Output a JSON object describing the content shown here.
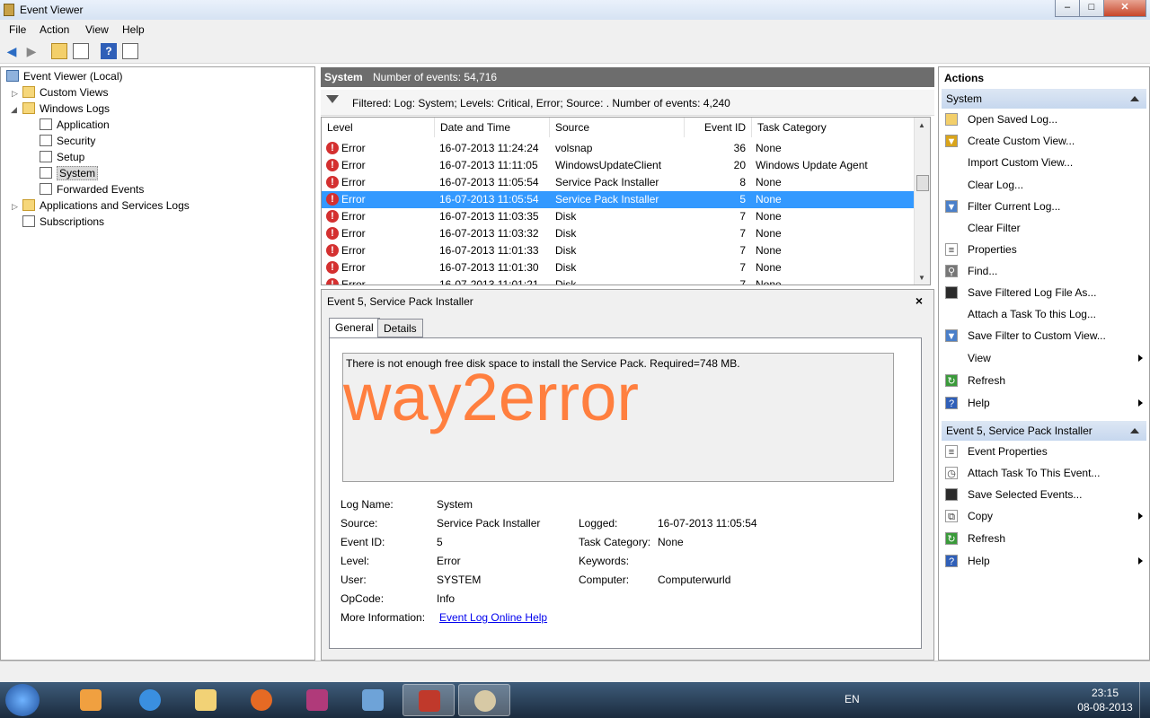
{
  "window": {
    "title": "Event Viewer",
    "min": "–",
    "max": "□",
    "close": "✕"
  },
  "menu": [
    "File",
    "Action",
    "View",
    "Help"
  ],
  "tree": {
    "root": "Event Viewer (Local)",
    "custom_views": "Custom Views",
    "windows_logs": "Windows Logs",
    "logs": [
      "Application",
      "Security",
      "Setup",
      "System",
      "Forwarded Events"
    ],
    "apps_services": "Applications and Services Logs",
    "subscriptions": "Subscriptions"
  },
  "center": {
    "log_name": "System",
    "event_count": "Number of events: 54,716",
    "filter_text": "Filtered: Log: System; Levels: Critical, Error; Source: . Number of events: 4,240",
    "columns": [
      "Level",
      "Date and Time",
      "Source",
      "Event ID",
      "Task Category"
    ],
    "rows": [
      {
        "level": "Error",
        "date": "16-07-2013 11:24:24",
        "source": "volsnap",
        "id": "36",
        "task": "None"
      },
      {
        "level": "Error",
        "date": "16-07-2013 11:11:05",
        "source": "WindowsUpdateClient",
        "id": "20",
        "task": "Windows Update Agent"
      },
      {
        "level": "Error",
        "date": "16-07-2013 11:05:54",
        "source": "Service Pack Installer",
        "id": "8",
        "task": "None"
      },
      {
        "level": "Error",
        "date": "16-07-2013 11:05:54",
        "source": "Service Pack Installer",
        "id": "5",
        "task": "None"
      },
      {
        "level": "Error",
        "date": "16-07-2013 11:03:35",
        "source": "Disk",
        "id": "7",
        "task": "None"
      },
      {
        "level": "Error",
        "date": "16-07-2013 11:03:32",
        "source": "Disk",
        "id": "7",
        "task": "None"
      },
      {
        "level": "Error",
        "date": "16-07-2013 11:01:33",
        "source": "Disk",
        "id": "7",
        "task": "None"
      },
      {
        "level": "Error",
        "date": "16-07-2013 11:01:30",
        "source": "Disk",
        "id": "7",
        "task": "None"
      },
      {
        "level": "Error",
        "date": "16-07-2013 11:01:21",
        "source": "Disk",
        "id": "7",
        "task": "None"
      }
    ],
    "selected_row": 3
  },
  "detail": {
    "title": "Event 5, Service Pack Installer",
    "close": "×",
    "tabs": [
      "General",
      "Details"
    ],
    "message": "There is not enough free disk space to install the Service Pack. Required=748 MB.",
    "watermark": "way2error",
    "labels": {
      "log_name": "Log Name:",
      "source": "Source:",
      "event_id": "Event ID:",
      "level": "Level:",
      "user": "User:",
      "opcode": "OpCode:",
      "more_info": "More Information:",
      "logged": "Logged:",
      "task_category": "Task Category:",
      "keywords": "Keywords:",
      "computer": "Computer:"
    },
    "values": {
      "log_name": "System",
      "source": "Service Pack Installer",
      "event_id": "5",
      "level": "Error",
      "user": "SYSTEM",
      "opcode": "Info",
      "more_info_link": "Event Log Online Help",
      "logged": "16-07-2013 11:05:54",
      "task_category": "None",
      "keywords": "",
      "computer": "Computerwurld"
    }
  },
  "actions": {
    "title": "Actions",
    "section1": "System",
    "items1": [
      "Open Saved Log...",
      "Create Custom View...",
      "Import Custom View...",
      "Clear Log...",
      "Filter Current Log...",
      "Clear Filter",
      "Properties",
      "Find...",
      "Save Filtered Log File As...",
      "Attach a Task To this Log...",
      "Save Filter to Custom View...",
      "View",
      "Refresh",
      "Help"
    ],
    "section2": "Event 5, Service Pack Installer",
    "items2": [
      "Event Properties",
      "Attach Task To This Event...",
      "Save Selected Events...",
      "Copy",
      "Refresh",
      "Help"
    ]
  },
  "taskbar": {
    "lang": "EN",
    "time": "23:15",
    "date": "08-08-2013"
  },
  "colors": {
    "selection": "#3399ff",
    "error": "#d43030",
    "watermark": "#ff7f3f"
  }
}
